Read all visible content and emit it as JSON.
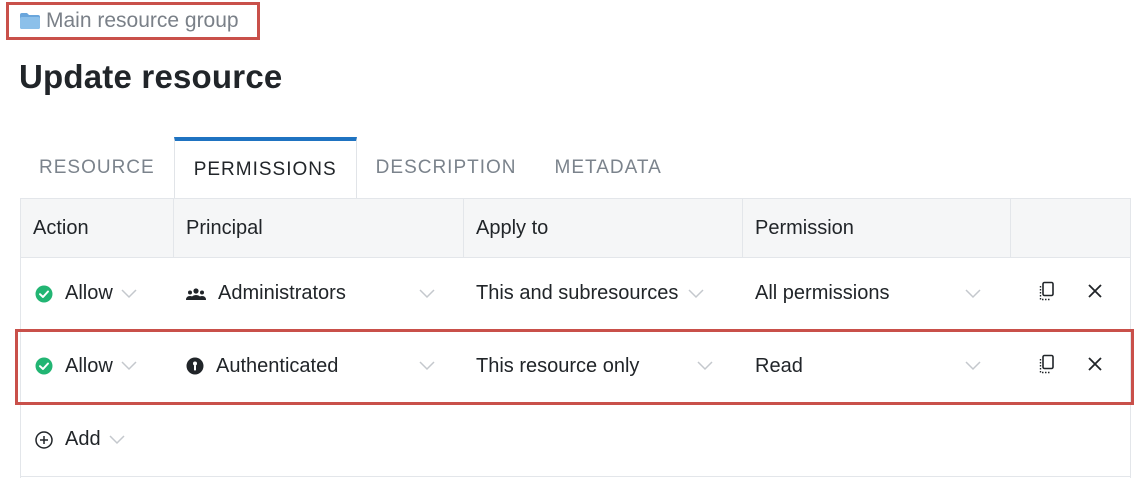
{
  "breadcrumb": {
    "label": "Main resource group",
    "icon": "folder-icon"
  },
  "page": {
    "title": "Update resource"
  },
  "tabs": [
    {
      "label": "RESOURCE",
      "active": false
    },
    {
      "label": "PERMISSIONS",
      "active": true
    },
    {
      "label": "DESCRIPTION",
      "active": false
    },
    {
      "label": "METADATA",
      "active": false
    }
  ],
  "table": {
    "headers": [
      "Action",
      "Principal",
      "Apply to",
      "Permission"
    ],
    "rows": [
      {
        "action": "Allow",
        "action_icon": "check-circle-icon",
        "principal": "Administrators",
        "principal_icon": "group-icon",
        "apply_to": "This and subresources",
        "permission": "All permissions"
      },
      {
        "action": "Allow",
        "action_icon": "check-circle-icon",
        "principal": "Authenticated",
        "principal_icon": "authenticated-icon",
        "apply_to": "This resource only",
        "permission": "Read"
      }
    ],
    "add_label": "Add"
  },
  "colors": {
    "accent": "#1f73c1",
    "allow_green": "#22b573",
    "highlight_red": "#c9504a"
  }
}
